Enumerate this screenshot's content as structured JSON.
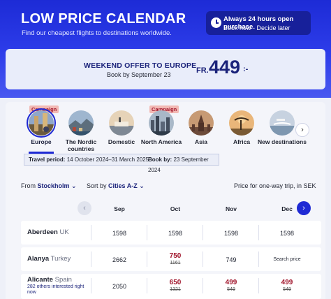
{
  "header": {
    "title": "LOW PRICE CALENDAR",
    "subtitle": "Find our cheapest flights to destinations worldwide.",
    "promo_line1": "Always 24 hours open purchase",
    "promo_line2": "Book now - Decide later"
  },
  "offer": {
    "title": "WEEKEND OFFER TO EUROPE",
    "subtitle": "Book by September 23",
    "currency": "FR.",
    "price": "449",
    "price_suffix": ":-"
  },
  "destinations": [
    {
      "label": "Europe",
      "campaign": "Campaign",
      "selected": true
    },
    {
      "label": "The Nordic countries"
    },
    {
      "label": "Domestic"
    },
    {
      "label": "North America",
      "campaign": "Campaign"
    },
    {
      "label": "Asia"
    },
    {
      "label": "Africa"
    },
    {
      "label": "New destinations"
    }
  ],
  "travel_info": {
    "period_label": "Travel period:",
    "period_value": "14 October 2024–31 March 2025",
    "book_label": "Book by:",
    "book_value": "23 September 2024"
  },
  "controls": {
    "from_label": "From",
    "from_value": "Stockholm",
    "sort_label": "Sort by",
    "sort_value": "Cities A-Z",
    "note": "Price for one-way trip, in SEK"
  },
  "months": [
    "Sep",
    "Oct",
    "Nov",
    "Dec"
  ],
  "rows": [
    {
      "city": "Aberdeen",
      "country": "UK",
      "cells": [
        {
          "price": "1598"
        },
        {
          "price": "1598"
        },
        {
          "price": "1598"
        },
        {
          "price": "1598"
        }
      ]
    },
    {
      "city": "Alanya",
      "country": "Turkey",
      "cells": [
        {
          "price": "2662"
        },
        {
          "price": "750",
          "old": "1161",
          "sale": true
        },
        {
          "price": "749"
        },
        {
          "search": "Search price"
        }
      ]
    },
    {
      "city": "Alicante",
      "country": "Spain",
      "note": "282 others interested right now",
      "cells": [
        {
          "price": "2050"
        },
        {
          "price": "650",
          "old": "1321",
          "sale": true
        },
        {
          "price": "499",
          "old": "549",
          "sale": true
        },
        {
          "price": "499",
          "old": "549",
          "sale": true
        }
      ]
    }
  ],
  "colors": {
    "primary": "#1f2ad4",
    "sale": "#a1162c",
    "campaign_bg": "#f2b9b4"
  }
}
